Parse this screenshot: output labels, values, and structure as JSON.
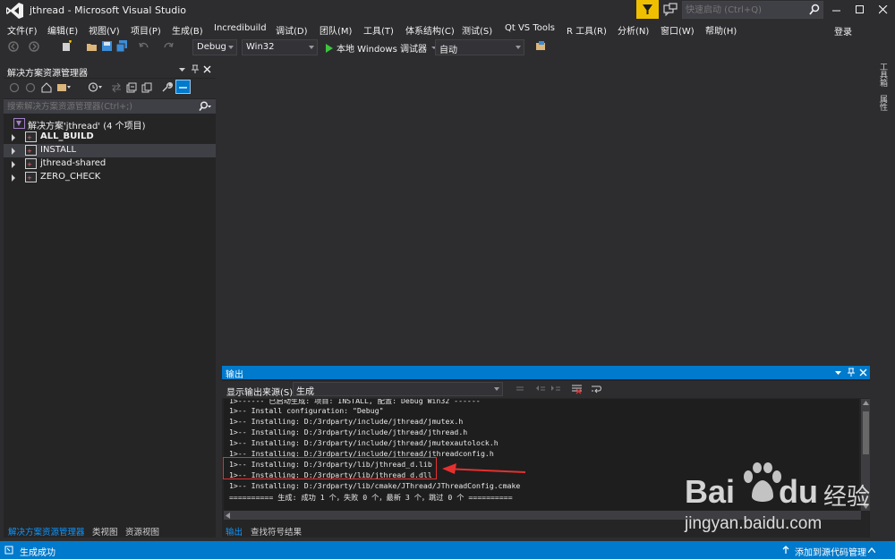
{
  "window": {
    "title": "jthread - Microsoft Visual Studio",
    "quicklaunch_placeholder": "快速启动 (Ctrl+Q)"
  },
  "menu": {
    "items": [
      "文件(F)",
      "编辑(E)",
      "视图(V)",
      "项目(P)",
      "生成(B)",
      "Incredibuild",
      "调试(D)",
      "团队(M)",
      "工具(T)",
      "体系结构(C)",
      "测试(S)",
      "Qt VS Tools",
      "R 工具(R)",
      "分析(N)",
      "窗口(W)",
      "帮助(H)"
    ],
    "signin": "登录"
  },
  "toolbar": {
    "config": "Debug",
    "platform": "Win32",
    "run_label": "本地 Windows 调试器",
    "mode": "自动"
  },
  "solution_explorer": {
    "title": "解决方案资源管理器",
    "search_placeholder": "搜索解决方案资源管理器(Ctrl+;)",
    "solution": "解决方案'jthread' (4 个项目)",
    "projects": [
      {
        "name": "ALL_BUILD",
        "bold": true
      },
      {
        "name": "INSTALL",
        "selected": true
      },
      {
        "name": "jthread-shared"
      },
      {
        "name": "ZERO_CHECK"
      }
    ],
    "bottom_tabs": [
      "解决方案资源管理器",
      "类视图",
      "资源视图"
    ]
  },
  "side_tabs": [
    "工具箱",
    "属性"
  ],
  "output": {
    "title": "输出",
    "source_label": "显示输出来源(S):",
    "source_value": "生成",
    "lines": [
      "1>------ 已启动生成: 项目: INSTALL, 配置: Debug Win32 ------",
      "1>-- Install configuration: \"Debug\"",
      "1>-- Installing: D:/3rdparty/include/jthread/jmutex.h",
      "1>-- Installing: D:/3rdparty/include/jthread/jthread.h",
      "1>-- Installing: D:/3rdparty/include/jthread/jmutexautolock.h",
      "1>-- Installing: D:/3rdparty/include/jthread/jthreadconfig.h",
      "1>-- Installing: D:/3rdparty/lib/jthread_d.lib",
      "1>-- Installing: D:/3rdparty/lib/jthread_d.dll",
      "1>-- Installing: D:/3rdparty/lib/cmake/JThread/JThreadConfig.cmake",
      "========== 生成: 成功 1 个，失败 0 个，最新 3 个，跳过 0 个 =========="
    ],
    "tabs": [
      "输出",
      "查找符号结果"
    ]
  },
  "status": {
    "text": "生成成功",
    "source_control": "添加到源代码管理"
  },
  "colors": {
    "accent": "#007acc",
    "highlight": "#e53030"
  },
  "watermark": {
    "brand": "Bai",
    "brand2": "du",
    "cn": "经验",
    "url": "jingyan.baidu.com"
  }
}
